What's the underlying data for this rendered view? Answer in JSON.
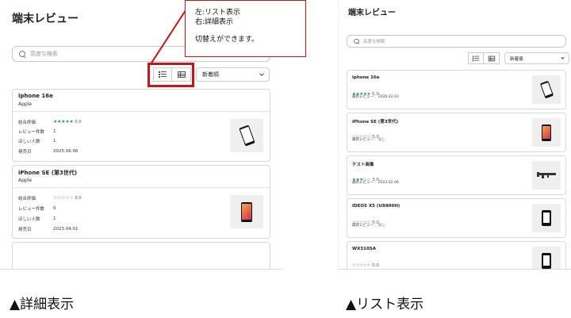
{
  "left_panel": {
    "title": "端末レビュー",
    "search_placeholder": "高度な検索",
    "sort_label": "新着順",
    "cards": [
      {
        "name": "iphone 16e",
        "maker": "Apple",
        "rating_label": "総合評価",
        "rating_stars": "★★★★★",
        "rating_value": "5.0",
        "review_count_label": "レビュー件数",
        "review_count": "1",
        "want_label": "ほしい人数",
        "want_count": "1",
        "release_label": "発売日",
        "release_date": "2025.06.06"
      },
      {
        "name": "iPhone SE (第3世代)",
        "maker": "Apple",
        "rating_label": "総合評価",
        "rating_stars": "☆☆☆☆☆",
        "rating_value": "0.0",
        "review_count_label": "レビュー件数",
        "review_count": "0",
        "want_label": "ほしい人数",
        "want_count": "1",
        "release_label": "発売日",
        "release_date": "2023.04.01"
      }
    ]
  },
  "callout": {
    "line1": "左:リスト表示",
    "line2": "右:詳細表示",
    "line3": "切替えができます。"
  },
  "right_panel": {
    "title": "端末レビュー",
    "search_placeholder": "高度な検索",
    "sort_label": "新着順",
    "cards": [
      {
        "name": "iphone 16e",
        "stars_filled": "★★★★★",
        "stars_empty": "",
        "rating_value": "5.0",
        "latest": "最新レビュー： 2026.02.03"
      },
      {
        "name": "iPhone SE (第3世代)",
        "stars_filled": "",
        "stars_empty": "☆☆☆☆☆",
        "rating_value": "0.0",
        "latest": "最新レビュー： なし"
      },
      {
        "name": "テスト画像",
        "stars_filled": "★★★",
        "stars_empty": "☆☆",
        "rating_value": "3.0",
        "latest": "最新レビュー： 2023.02.06"
      },
      {
        "name": "IDEOS X5 (U8800H)",
        "stars_filled": "",
        "stars_empty": "☆☆☆☆☆",
        "rating_value": "0.0",
        "latest": "最新レビュー： なし"
      },
      {
        "name": "WX310SA",
        "stars_filled": "",
        "stars_empty": "☆☆☆☆☆",
        "rating_value": "0.0",
        "latest": ""
      }
    ]
  },
  "captions": {
    "left": "▲詳細表示",
    "right": "▲リスト表示"
  },
  "colors": {
    "star_green": "#2e9e4e",
    "highlight_red": "#c0161c"
  },
  "icons": [
    "search-icon",
    "list-view-icon",
    "detail-view-icon",
    "chevron-down-icon"
  ]
}
